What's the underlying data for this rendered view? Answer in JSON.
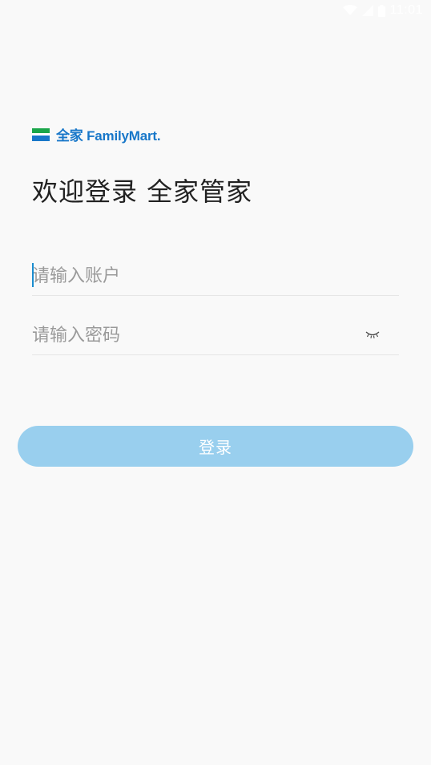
{
  "status_bar": {
    "time": "11:01",
    "icons": [
      "wifi-icon",
      "signal-icon",
      "battery-icon"
    ]
  },
  "logo": {
    "text": "全家 FamilyMart."
  },
  "welcome_title": "欢迎登录  全家管家",
  "account_field": {
    "placeholder": "请输入账户",
    "value": ""
  },
  "password_field": {
    "placeholder": "请输入密码",
    "value": "",
    "visibility_icon": "eye-closed-icon"
  },
  "login_button": {
    "label": "登录"
  },
  "colors": {
    "background": "#f9f9f9",
    "brand_blue": "#1877c9",
    "brand_green": "#1aa64a",
    "button": "#99cfee",
    "cursor": "#1a8ccf"
  }
}
